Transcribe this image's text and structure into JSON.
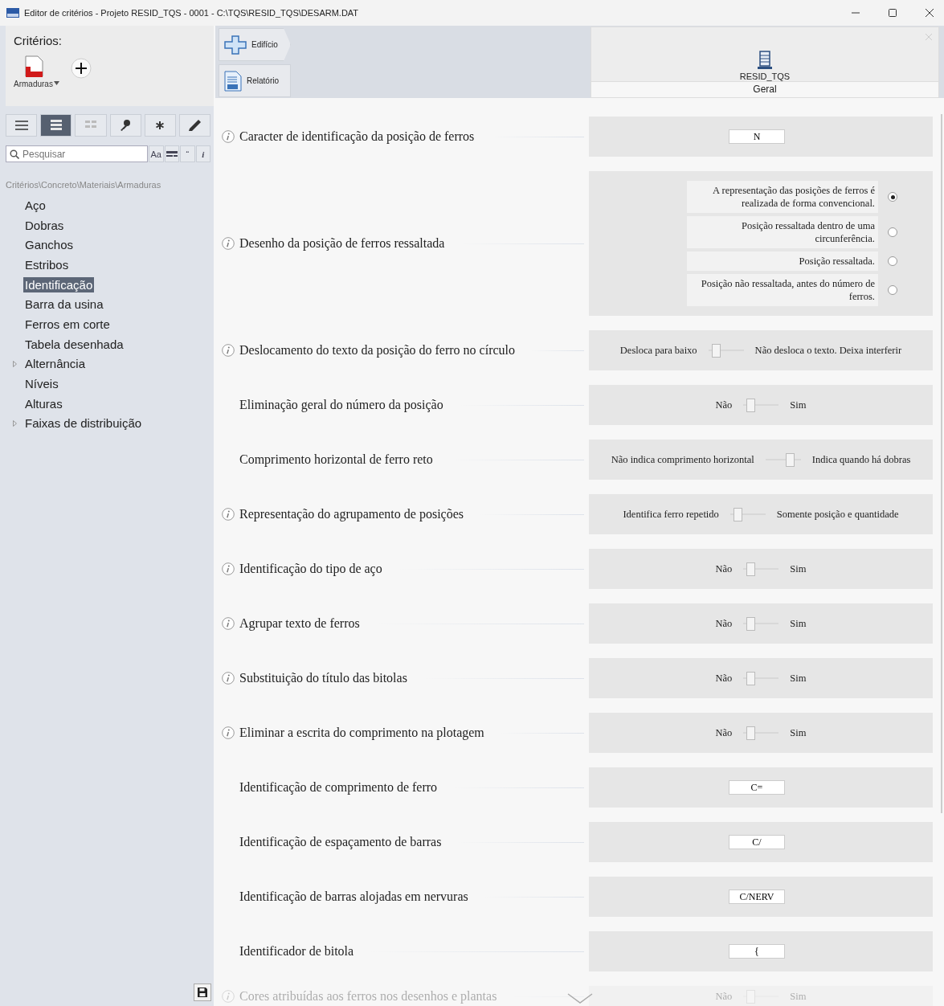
{
  "window": {
    "title": "Editor de critérios - Projeto RESID_TQS - 0001 - C:\\TQS\\RESID_TQS\\DESARM.DAT"
  },
  "sidebar": {
    "title": "Critérios:",
    "category": {
      "label": "Armaduras"
    },
    "view_buttons": [
      {
        "kind": "list",
        "selected": false,
        "disabled": false
      },
      {
        "kind": "list-bold",
        "selected": true,
        "disabled": false
      },
      {
        "kind": "grid",
        "selected": false,
        "disabled": true
      },
      {
        "kind": "key",
        "selected": false,
        "disabled": false
      },
      {
        "kind": "star",
        "selected": false,
        "disabled": false
      },
      {
        "kind": "pencil",
        "selected": false,
        "disabled": false
      }
    ],
    "search": {
      "placeholder": "Pesquisar"
    },
    "search_options": [
      {
        "kind": "text",
        "label": "Aa"
      },
      {
        "kind": "icon"
      },
      {
        "kind": "text",
        "label": "“"
      },
      {
        "kind": "italic",
        "label": "i"
      }
    ],
    "breadcrumb": "Critérios\\Concreto\\Materiais\\Armaduras",
    "tree": [
      {
        "label": "Aço",
        "selected": false,
        "collapsed": false
      },
      {
        "label": "Dobras",
        "selected": false,
        "collapsed": false
      },
      {
        "label": "Ganchos",
        "selected": false,
        "collapsed": false
      },
      {
        "label": "Estribos",
        "selected": false,
        "collapsed": false
      },
      {
        "label": "Identificação",
        "selected": true,
        "collapsed": false
      },
      {
        "label": "Barra da usina",
        "selected": false,
        "collapsed": false
      },
      {
        "label": "Ferros em corte",
        "selected": false,
        "collapsed": false
      },
      {
        "label": "Tabela desenhada",
        "selected": false,
        "collapsed": false
      },
      {
        "label": "Alternância",
        "selected": false,
        "collapsed": true
      },
      {
        "label": "Níveis",
        "selected": false,
        "collapsed": false
      },
      {
        "label": "Alturas",
        "selected": false,
        "collapsed": false
      },
      {
        "label": "Faixas de distribuição",
        "selected": false,
        "collapsed": true
      }
    ]
  },
  "header": {
    "buttons": [
      {
        "kind": "building",
        "label": "Edifício"
      },
      {
        "kind": "report",
        "label": "Relatório"
      }
    ],
    "card": {
      "title": "RESID_TQS",
      "tab": "Geral"
    }
  },
  "rows": [
    {
      "label": "Caracter de identificação da posição de ferros",
      "info": true,
      "faded": false,
      "kind": "text",
      "value": "N"
    },
    {
      "label": "Desenho da posição de ferros ressaltada",
      "info": true,
      "faded": false,
      "kind": "radio",
      "options": [
        {
          "label": "A representação das posições de ferros é realizada de forma convencional.",
          "selected": true
        },
        {
          "label": "Posição ressaltada dentro de uma circunferência.",
          "selected": false
        },
        {
          "label": "Posição ressaltada.",
          "selected": false
        },
        {
          "label": "Posição não ressaltada, antes do número de ferros.",
          "selected": false
        }
      ]
    },
    {
      "label": "Deslocamento do texto da posição do ferro no círculo",
      "info": true,
      "faded": false,
      "kind": "toggle",
      "off_label": "Desloca para baixo",
      "on_label": "Não desloca o texto. Deixa interferir",
      "on": false
    },
    {
      "label": "Eliminação geral do número da posição",
      "info": false,
      "faded": false,
      "kind": "toggle",
      "off_label": "Não",
      "on_label": "Sim",
      "on": false
    },
    {
      "label": "Comprimento horizontal de ferro reto",
      "info": false,
      "faded": false,
      "kind": "toggle",
      "off_label": "Não indica comprimento horizontal",
      "on_label": "Indica quando há dobras",
      "on": true
    },
    {
      "label": "Representação do agrupamento de posições",
      "info": true,
      "faded": false,
      "kind": "toggle",
      "off_label": "Identifica ferro repetido",
      "on_label": "Somente posição e quantidade",
      "on": false
    },
    {
      "label": "Identificação do tipo de aço",
      "info": true,
      "faded": false,
      "kind": "toggle",
      "off_label": "Não",
      "on_label": "Sim",
      "on": false
    },
    {
      "label": "Agrupar texto de ferros",
      "info": true,
      "faded": false,
      "kind": "toggle",
      "off_label": "Não",
      "on_label": "Sim",
      "on": false
    },
    {
      "label": "Substituição do título das bitolas",
      "info": true,
      "faded": false,
      "kind": "toggle",
      "off_label": "Não",
      "on_label": "Sim",
      "on": false
    },
    {
      "label": "Eliminar a escrita do comprimento na plotagem",
      "info": true,
      "faded": false,
      "kind": "toggle",
      "off_label": "Não",
      "on_label": "Sim",
      "on": false
    },
    {
      "label": "Identificação de comprimento de ferro",
      "info": false,
      "faded": false,
      "kind": "text",
      "value": "C="
    },
    {
      "label": "Identificação de espaçamento de barras",
      "info": false,
      "faded": false,
      "kind": "text",
      "value": "C/"
    },
    {
      "label": "Identificação de barras alojadas em nervuras",
      "info": false,
      "faded": false,
      "kind": "text",
      "value": "C/NERV"
    },
    {
      "label": "Identificador de bitola",
      "info": false,
      "faded": false,
      "kind": "text",
      "value": "{"
    },
    {
      "label": "Cores atribuídas aos ferros nos desenhos e plantas",
      "info": true,
      "faded": true,
      "kind": "toggle",
      "off_label": "Não",
      "on_label": "Sim",
      "on": false
    }
  ]
}
